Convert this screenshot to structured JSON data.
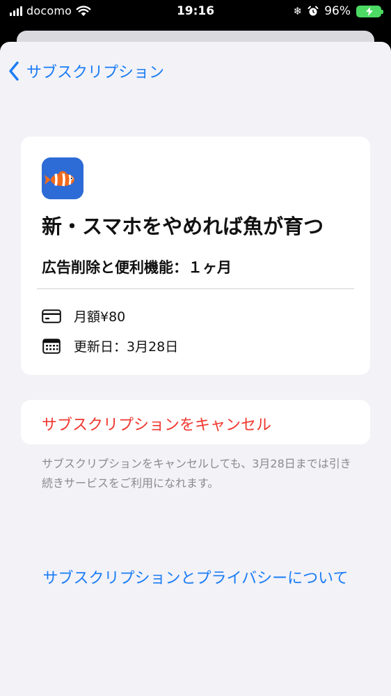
{
  "status_bar": {
    "carrier": "docomo",
    "time": "19:16",
    "battery_percent": "96%",
    "battery_level": 0.96
  },
  "nav": {
    "back_label": "サブスクリプション"
  },
  "subscription": {
    "app_name": "新・スマホをやめれば魚が育つ",
    "plan": "広告削除と便利機能：１ヶ月",
    "price": "月額¥80",
    "renewal": "更新日：3月28日"
  },
  "actions": {
    "cancel_label": "サブスクリプションをキャンセル",
    "cancel_note": "サブスクリプションをキャンセルしても、3月28日までは引き続きサービスをご利用になれます。",
    "privacy_link": "サブスクリプションとプライバシーについて"
  },
  "colors": {
    "accent": "#1a7cf5",
    "destructive": "#f0372f",
    "background": "#f2f2f7",
    "battery": "#4cd964"
  }
}
